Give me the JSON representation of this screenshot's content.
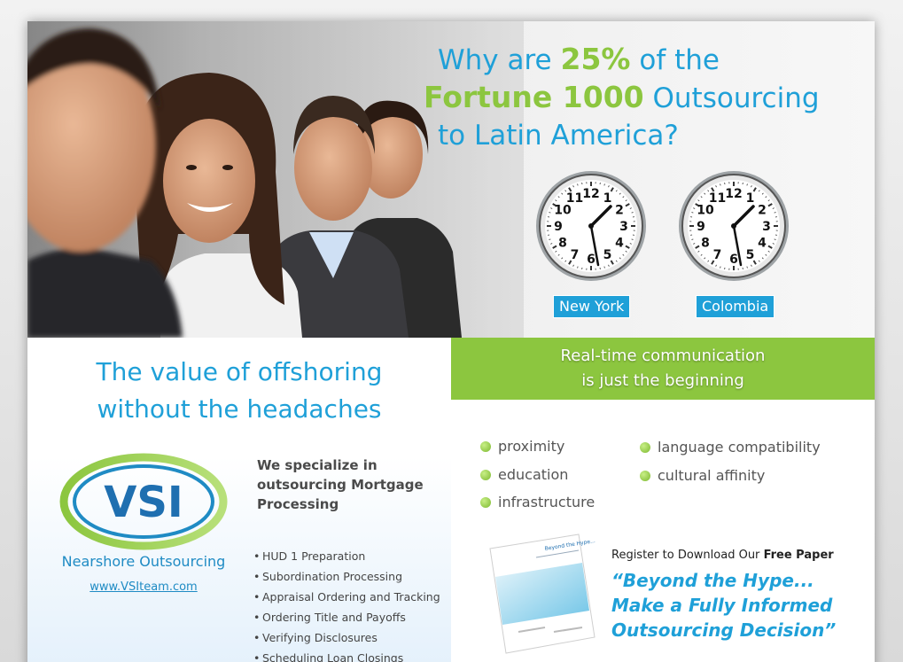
{
  "headline": {
    "line1_pre": "Why are",
    "line1_pct": "25%",
    "line1_post": "of the",
    "line2_brand": "Fortune 1000",
    "line2_post": "Outsourcing",
    "line3": "to Latin America?"
  },
  "clocks": [
    {
      "label": "New York"
    },
    {
      "label": "Colombia"
    }
  ],
  "clock_numbers": [
    "12",
    "1",
    "2",
    "3",
    "4",
    "5",
    "6",
    "7",
    "8",
    "9",
    "10",
    "11"
  ],
  "left": {
    "tagline_1": "The value of offshoring",
    "tagline_2": "without the headaches",
    "logo_text": "VSI",
    "logo_sub": "Nearshore Outsourcing",
    "logo_url": "www.VSIteam.com",
    "spec_title": "We specialize in outsourcing Mortgage Processing",
    "services": [
      "HUD 1 Preparation",
      "Subordination Processing",
      "Appraisal Ordering and Tracking",
      "Ordering Title and Payoffs",
      "Verifying Disclosures",
      "Scheduling Loan Closings"
    ]
  },
  "right": {
    "band_1": "Real-time communication",
    "band_2": "is just the beginning",
    "features": [
      "proximity",
      "education",
      "infrastructure",
      "language compatibility",
      "cultural affinity"
    ],
    "register_pre": "Register to Download Our",
    "register_bold": "Free Paper",
    "quote_1": "“Beyond the Hype...",
    "quote_2": "Make a Fully Informed",
    "quote_3": "Outsourcing Decision”",
    "paper_title": "Beyond the Hype..."
  },
  "colors": {
    "blue": "#1fa0d8",
    "green": "#8cc63f"
  }
}
